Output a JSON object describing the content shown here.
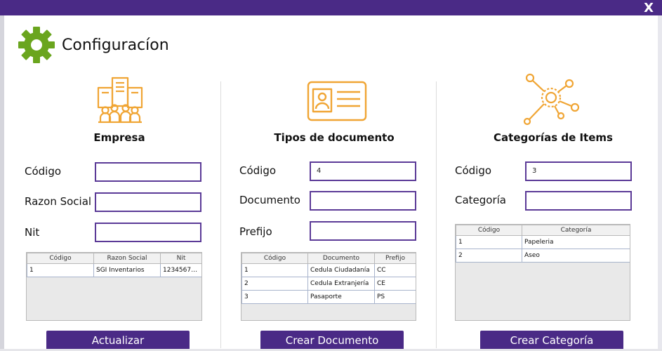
{
  "window": {
    "close_label": "X"
  },
  "header": {
    "title": "Configuracíon"
  },
  "empresa": {
    "title": "Empresa",
    "labels": {
      "codigo": "Código",
      "razon_social": "Razon Social",
      "nit": "Nit"
    },
    "values": {
      "codigo": "",
      "razon_social": "",
      "nit": ""
    },
    "table": {
      "columns": [
        "Código",
        "Razon Social",
        "Nit"
      ],
      "rows": [
        [
          "1",
          "SGI Inventarios",
          "123456789..."
        ]
      ]
    },
    "button": "Actualizar"
  },
  "tipos": {
    "title": "Tipos de documento",
    "labels": {
      "codigo": "Código",
      "documento": "Documento",
      "prefijo": "Prefijo"
    },
    "values": {
      "codigo": "4",
      "documento": "",
      "prefijo": ""
    },
    "table": {
      "columns": [
        "Código",
        "Documento",
        "Prefijo"
      ],
      "rows": [
        [
          "1",
          "Cedula Ciudadanía",
          "CC"
        ],
        [
          "2",
          "Cedula Extranjería",
          "CE"
        ],
        [
          "3",
          "Pasaporte",
          "PS"
        ]
      ]
    },
    "button": "Crear Documento"
  },
  "categorias": {
    "title": "Categorías de Items",
    "labels": {
      "codigo": "Código",
      "categoria": "Categoría"
    },
    "values": {
      "codigo": "3",
      "categoria": ""
    },
    "table": {
      "columns": [
        "Código",
        "Categoría"
      ],
      "rows": [
        [
          "1",
          "Papeleria"
        ],
        [
          "2",
          "Aseo"
        ]
      ]
    },
    "button": "Crear Categoría"
  },
  "colors": {
    "accent": "#4a2a86",
    "icon_orange": "#f0a534",
    "gear_green": "#6aa51e"
  },
  "icons": {
    "header": "gear-icon",
    "empresa": "building-people-icon",
    "tipos": "id-card-icon",
    "categorias": "network-icon"
  }
}
